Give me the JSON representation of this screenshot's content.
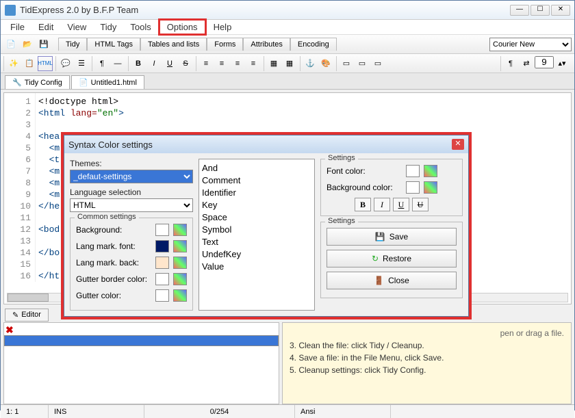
{
  "app": {
    "title": "TidExpress 2.0 by B.F.P Team"
  },
  "menu": {
    "file": "File",
    "edit": "Edit",
    "view": "View",
    "tidy": "Tidy",
    "tools": "Tools",
    "options": "Options",
    "help": "Help"
  },
  "topTabs": {
    "tidy": "Tidy",
    "htmltags": "HTML Tags",
    "tables": "Tables and lists",
    "forms": "Forms",
    "attributes": "Attributes",
    "encoding": "Encoding"
  },
  "font": {
    "family": "Courier New",
    "size": "9"
  },
  "fileTabs": {
    "tidyconfig": "Tidy Config",
    "untitled": "Untitled1.html"
  },
  "editor": {
    "lines": [
      "1",
      "2",
      "3",
      "4",
      "5",
      "6",
      "7",
      "8",
      "9",
      "10",
      "11",
      "12",
      "13",
      "14",
      "15",
      "16"
    ]
  },
  "bottomTabs": {
    "editor": "Editor"
  },
  "hints": {
    "l3": "3. Clean the file: click Tidy / Cleanup.",
    "l4": "4. Save a file: in the File Menu, click Save.",
    "l5": "5. Cleanup settings: click Tidy Config.",
    "tip": "pen or drag a file."
  },
  "status": {
    "pos": "1:  1",
    "ins": "INS",
    "bytes": "0/254",
    "enc": "Ansi"
  },
  "dialog": {
    "title": "Syntax Color settings",
    "themesLabel": "Themes:",
    "themeValue": "_defaut-settings",
    "langLabel": "Language selection",
    "langValue": "HTML",
    "common": {
      "legend": "Common settings",
      "bg": "Background:",
      "lmfont": "Lang mark. font:",
      "lmback": "Lang mark. back:",
      "gborder": "Gutter border color:",
      "gcolor": "Gutter color:"
    },
    "tokens": {
      "and": "And",
      "comment": "Comment",
      "identifier": "Identifier",
      "key": "Key",
      "space": "Space",
      "symbol": "Symbol",
      "text": "Text",
      "undef": "UndefKey",
      "value": "Value"
    },
    "settings": {
      "legend": "Settings",
      "fontcolor": "Font color:",
      "bgcolor": "Background color:"
    },
    "actions": {
      "legend": "Settings",
      "save": "Save",
      "restore": "Restore",
      "close": "Close"
    }
  }
}
